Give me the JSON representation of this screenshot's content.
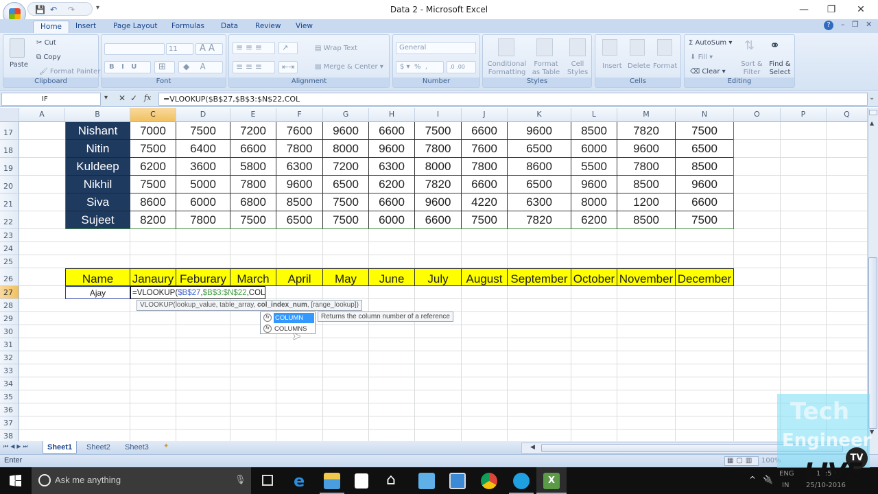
{
  "window": {
    "title": "Data 2 - Microsoft Excel",
    "minimize_label": "—",
    "restore_label": "❐",
    "close_label": "✕"
  },
  "quick_access": {
    "save": "💾",
    "undo": "↶",
    "redo": "↷",
    "customize": "▾"
  },
  "tabs": [
    {
      "label": "Home",
      "active": true
    },
    {
      "label": "Insert"
    },
    {
      "label": "Page Layout"
    },
    {
      "label": "Formulas"
    },
    {
      "label": "Data"
    },
    {
      "label": "Review"
    },
    {
      "label": "View"
    }
  ],
  "ribbon": {
    "clipboard": {
      "label": "Clipboard",
      "paste": "Paste",
      "cut": "Cut",
      "copy": "Copy",
      "format_painter": "Format Painter"
    },
    "font": {
      "label": "Font",
      "font_name": "",
      "font_size": "11",
      "bold": "B",
      "italic": "I",
      "underline": "U",
      "grow": "A",
      "shrink": "A"
    },
    "alignment": {
      "label": "Alignment",
      "wrap_text": "Wrap Text",
      "merge_center": "Merge & Center"
    },
    "number": {
      "label": "Number",
      "format": "General",
      "percent": "%",
      "comma": ",",
      "currency": "$"
    },
    "styles": {
      "label": "Styles",
      "conditional": "Conditional Formatting",
      "format_table": "Format as Table",
      "cell_styles": "Cell Styles"
    },
    "cells": {
      "label": "Cells",
      "insert": "Insert",
      "delete": "Delete",
      "format": "Format"
    },
    "editing": {
      "label": "Editing",
      "autosum": "AutoSum",
      "fill": "Fill",
      "clear": "Clear",
      "sort_filter": "Sort & Filter",
      "find_select": "Find & Select"
    }
  },
  "formula_bar": {
    "name_box": "IF",
    "cancel": "✕",
    "enter": "✓",
    "fx": "fx",
    "formula": "=VLOOKUP($B$27,$B$3:$N$22,COL"
  },
  "columns": [
    "A",
    "B",
    "C",
    "D",
    "E",
    "F",
    "G",
    "H",
    "I",
    "J",
    "K",
    "L",
    "M",
    "N",
    "O",
    "P",
    "Q"
  ],
  "selected_column": "C",
  "rows": [
    17,
    18,
    19,
    20,
    21,
    22,
    23,
    24,
    25,
    26,
    27,
    28,
    29,
    30,
    31,
    32,
    33,
    34,
    35,
    36,
    37,
    38
  ],
  "selected_row": 27,
  "data_table": [
    {
      "name": "Nishant",
      "values": [
        7000,
        7500,
        7200,
        7600,
        9600,
        6600,
        7500,
        6600,
        9600,
        8500,
        7820,
        7500
      ]
    },
    {
      "name": "Nitin",
      "values": [
        7500,
        6400,
        6600,
        7800,
        8000,
        9600,
        7800,
        7600,
        6500,
        6000,
        9600,
        6500
      ]
    },
    {
      "name": "Kuldeep",
      "values": [
        6200,
        3600,
        5800,
        6300,
        7200,
        6300,
        8000,
        7800,
        8600,
        5500,
        7800,
        8500
      ]
    },
    {
      "name": "Nikhil",
      "values": [
        7500,
        5000,
        7800,
        9600,
        6500,
        6200,
        7820,
        6600,
        6500,
        9600,
        8500,
        9600
      ]
    },
    {
      "name": "Siva",
      "values": [
        8600,
        6000,
        6800,
        8500,
        7500,
        6600,
        9600,
        4220,
        6300,
        8000,
        1200,
        6600
      ]
    },
    {
      "name": "Sujeet",
      "values": [
        8200,
        7800,
        7500,
        6500,
        7500,
        6000,
        6600,
        7500,
        7820,
        6200,
        8500,
        7500
      ]
    }
  ],
  "lookup_header": [
    "Name",
    "Janaury",
    "Feburary",
    "March",
    "April",
    "May",
    "June",
    "July",
    "August",
    "September",
    "October",
    "November",
    "December"
  ],
  "lookup_row": {
    "name": "Ajay",
    "formula_prefix": "=VLOOKUP(",
    "arg1": "$B$27",
    "sep1": ",",
    "arg2": "$B$3:$N$22",
    "rest": ",COL"
  },
  "tooltip": {
    "fn": "VLOOKUP(",
    "p1": "lookup_value, table_array, ",
    "p_current": "col_index_num",
    "p_rest": ", [range_lookup])"
  },
  "autocomplete": {
    "items": [
      "COLUMN",
      "COLUMNS"
    ],
    "highlighted": "COLUMN",
    "description": "Returns the column number of a reference"
  },
  "sheet_tabs": [
    {
      "label": "Sheet1",
      "active": true
    },
    {
      "label": "Sheet2"
    },
    {
      "label": "Sheet3"
    }
  ],
  "status": {
    "mode": "Enter",
    "zoom": "100%"
  },
  "taskbar": {
    "search_placeholder": "Ask me anything",
    "tray_lang": "ENG",
    "tray_region": "IN",
    "time": "15:50",
    "date": "25/10-2016"
  },
  "watermark": {
    "line1": "Tech",
    "line2": "Engineer",
    "live": "LIVE",
    "tv": "TV"
  },
  "colors": {
    "name_fill": "#1f3a5f",
    "header_fill": "#ffff00",
    "selection_orange": "#f1c15f",
    "ribbon_blue": "#c9daf0"
  }
}
